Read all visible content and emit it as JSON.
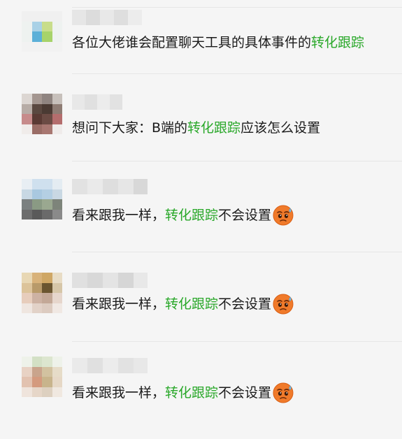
{
  "messages": [
    {
      "before": "各位大佬谁会配置聊天工具的具体事件的",
      "highlight": "转化跟踪",
      "after": "",
      "emoji": ""
    },
    {
      "before": "想问下大家：B端的",
      "highlight": "转化跟踪",
      "after": "应该怎么设置",
      "emoji": ""
    },
    {
      "before": "看来跟我一样，",
      "highlight": "转化跟踪",
      "after": "不会设置",
      "emoji": "sweat-face-emoji"
    },
    {
      "before": "看来跟我一样，",
      "highlight": "转化跟踪",
      "after": "不会设置",
      "emoji": "sweat-face-emoji"
    },
    {
      "before": "看来跟我一样，",
      "highlight": "转化跟踪",
      "after": "不会设置",
      "emoji": "sweat-face-emoji"
    }
  ],
  "colors": {
    "highlight": "#2aa82a",
    "background": "#f5f5f5",
    "text": "#1a1a1a"
  }
}
